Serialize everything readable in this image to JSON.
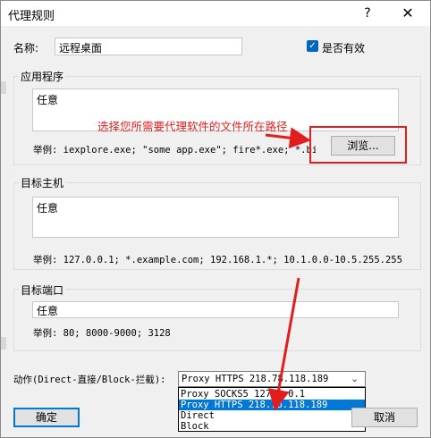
{
  "window": {
    "title": "代理规则",
    "help_glyph": "?",
    "close_glyph": "✕"
  },
  "name_field": {
    "label": "名称:",
    "value": "远程桌面"
  },
  "enabled_checkbox": {
    "label": "是否有效",
    "checked": true
  },
  "applications": {
    "group_title": "应用程序",
    "value": "任意",
    "example": "举例: iexplore.exe; \"some app.exe\"; fire*.exe; *.bin",
    "browse_label": "浏览..."
  },
  "target_hosts": {
    "group_title": "目标主机",
    "value": "任意",
    "example": "举例: 127.0.0.1; *.example.com; 192.168.1.*; 10.1.0.0-10.5.255.255"
  },
  "target_ports": {
    "group_title": "目标端口",
    "value": "任意",
    "example": "举例: 80; 8000-9000; 3128"
  },
  "action": {
    "label": "动作(Direct-直接/Block-拦截):",
    "selected": "Proxy HTTPS 218.78.118.189",
    "options": [
      "Proxy SOCKS5 127.0.0.1",
      "Proxy HTTPS 218.78.118.189",
      "Direct",
      "Block"
    ],
    "highlighted_index": 1
  },
  "buttons": {
    "ok": "确定",
    "cancel": "取消"
  },
  "annotation": {
    "text": "选择您所需要代理软件的文件所在路径",
    "color": "#e21d1d"
  }
}
